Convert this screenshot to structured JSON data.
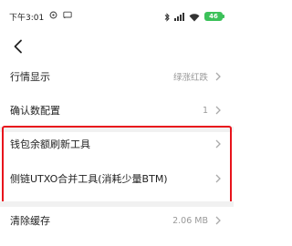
{
  "status_bar": {
    "time": "下午3:01",
    "battery": "46"
  },
  "settings": {
    "market_display": {
      "label": "行情显示",
      "value": "绿涨红跌"
    },
    "confirmations": {
      "label": "确认数配置",
      "value": "1"
    },
    "wallet_refresh": {
      "label": "钱包余额刷新工具"
    },
    "sidechain_merge": {
      "label": "侧链UTXO合并工具(消耗少量BTM)"
    },
    "clear_cache": {
      "label": "清除缓存",
      "value": "2.06 MB"
    }
  },
  "colors": {
    "highlight": "#e8141c",
    "battery": "#3cc15a",
    "secondary_text": "#999999"
  }
}
